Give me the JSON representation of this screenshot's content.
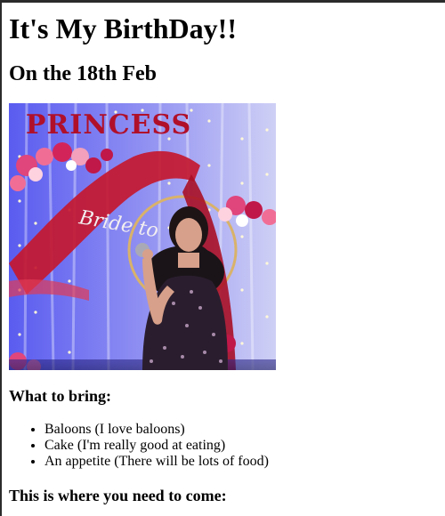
{
  "page": {
    "title": "It's My BirthDay!!",
    "date": "On the 18th Feb",
    "photo": {
      "banner_text": "PRINCESS",
      "arch_script": "Bride to"
    },
    "bring_heading": "What to bring:",
    "bring_items": [
      "Baloons (I love baloons)",
      "Cake (I'm really good at eating)",
      "An appetite (There will be lots of food)"
    ],
    "come_heading": "This is where you need to come:"
  },
  "colors": {
    "background": "#ffffff",
    "text": "#000000",
    "window_border": "#2b2b2b",
    "banner_red": "#b0102a",
    "curtain_blue": "#4c4bd6"
  }
}
